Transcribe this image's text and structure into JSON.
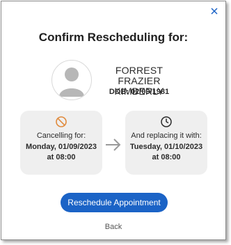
{
  "dialog": {
    "title": "Confirm Rescheduling for:",
    "close_icon": "close-icon"
  },
  "patient": {
    "name_line1": "FORREST  FRAZIER",
    "name_line2": "KIMBERLY",
    "dob": "DOB: 02/09/1981",
    "avatar_icon": "person-silhouette-icon"
  },
  "cancelling": {
    "icon": "no-entry-icon",
    "label": "Cancelling for:",
    "date": "Monday, 01/09/2023",
    "time": "at 08:00"
  },
  "replacing": {
    "icon": "clock-icon",
    "label": "And replacing it with:",
    "date": "Tuesday, 01/10/2023",
    "time": "at 08:00"
  },
  "actions": {
    "reschedule_label": "Reschedule Appointment",
    "back_label": "Back"
  },
  "colors": {
    "primary_button": "#1b63c6",
    "cancel_icon": "#e08a3c",
    "card_bg": "#efefef"
  }
}
